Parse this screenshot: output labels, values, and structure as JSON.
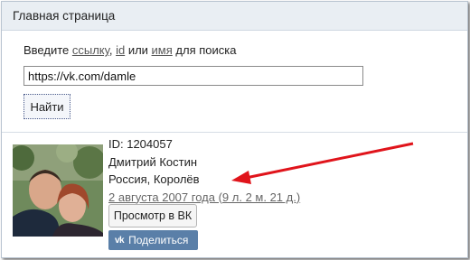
{
  "header": {
    "title": "Главная страница"
  },
  "search": {
    "prompt_before": "Введите ",
    "link_label": "ссылку",
    "sep1": ", ",
    "id_label": "id",
    "sep2": " или ",
    "name_label": "имя",
    "prompt_after": " для поиска",
    "value": "https://vk.com/damle",
    "button_label": "Найти"
  },
  "result": {
    "id_line": "ID: 1204057",
    "name": "Дмитрий Костин",
    "location": "Россия, Королёв",
    "registration_date": "2 августа 2007 года (9 л. 2 м. 21 д.)",
    "view_button": "Просмотр в ВК",
    "share_logo": "vk",
    "share_button": "Поделиться"
  },
  "colors": {
    "title_bg": "#e9eef3",
    "share_bg": "#5a7fa8",
    "arrow": "#e0141b"
  },
  "icons": {
    "avatar": "profile-photo",
    "share_logo": "vk-logo-icon",
    "annotation": "red-arrow-icon"
  }
}
